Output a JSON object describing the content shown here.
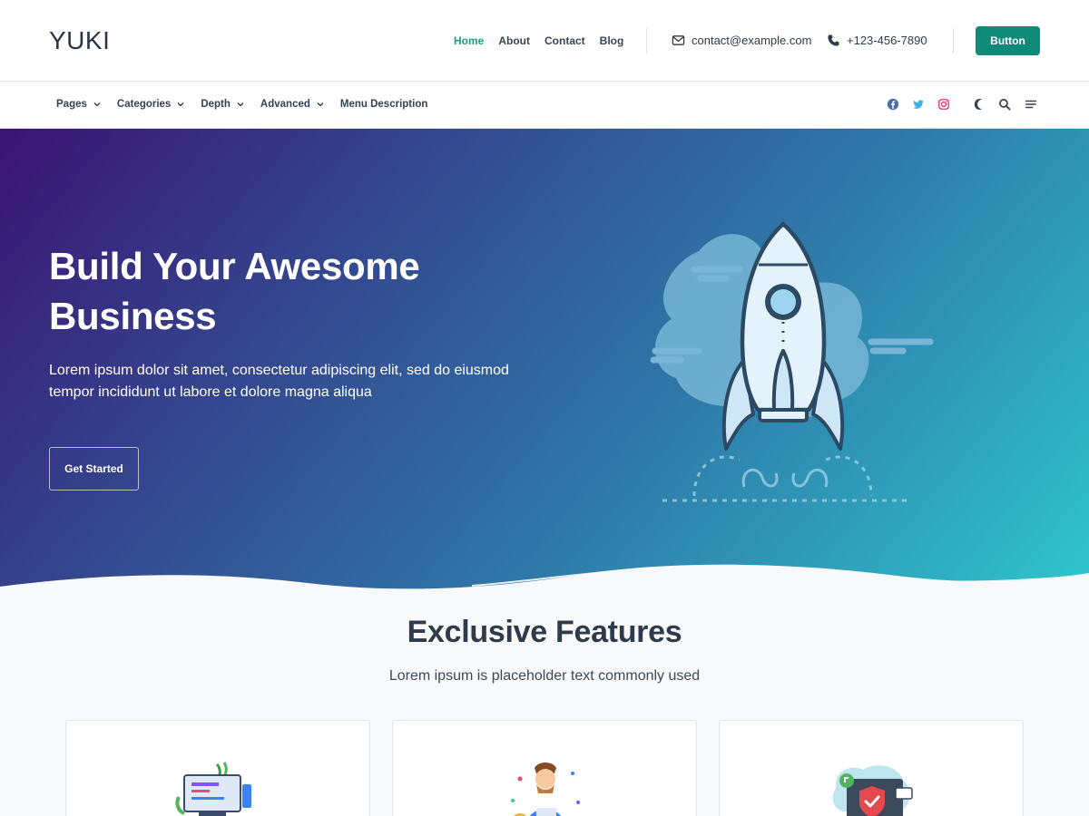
{
  "header": {
    "logo": "YUKI",
    "nav": [
      {
        "label": "Home",
        "active": true
      },
      {
        "label": "About",
        "active": false
      },
      {
        "label": "Contact",
        "active": false
      },
      {
        "label": "Blog",
        "active": false
      }
    ],
    "email": "contact@example.com",
    "phone": "+123-456-7890",
    "button_label": "Button",
    "accent_color": "#108a78"
  },
  "subnav": {
    "items": [
      {
        "label": "Pages",
        "has_dropdown": true
      },
      {
        "label": "Categories",
        "has_dropdown": true
      },
      {
        "label": "Depth",
        "has_dropdown": true
      },
      {
        "label": "Advanced",
        "has_dropdown": true
      },
      {
        "label": "Menu Description",
        "has_dropdown": false
      }
    ],
    "social_icons": [
      "facebook-icon",
      "twitter-icon",
      "instagram-icon"
    ],
    "tool_icons": [
      "moon-icon",
      "search-icon",
      "menu-icon"
    ]
  },
  "hero": {
    "title": "Build Your Awesome Business",
    "description": "Lorem ipsum dolor sit amet, consectetur adipiscing elit, sed do eiusmod tempor incididunt ut labore et dolore magna aliqua",
    "button_label": "Get Started",
    "gradient_colors": [
      "#3a1473",
      "#2fc6cc"
    ]
  },
  "features": {
    "title": "Exclusive Features",
    "subtitle": "Lorem ipsum is placeholder text commonly used",
    "cards": [
      {
        "icon": "coding-illustration"
      },
      {
        "icon": "person-illustration"
      },
      {
        "icon": "security-illustration"
      }
    ]
  }
}
